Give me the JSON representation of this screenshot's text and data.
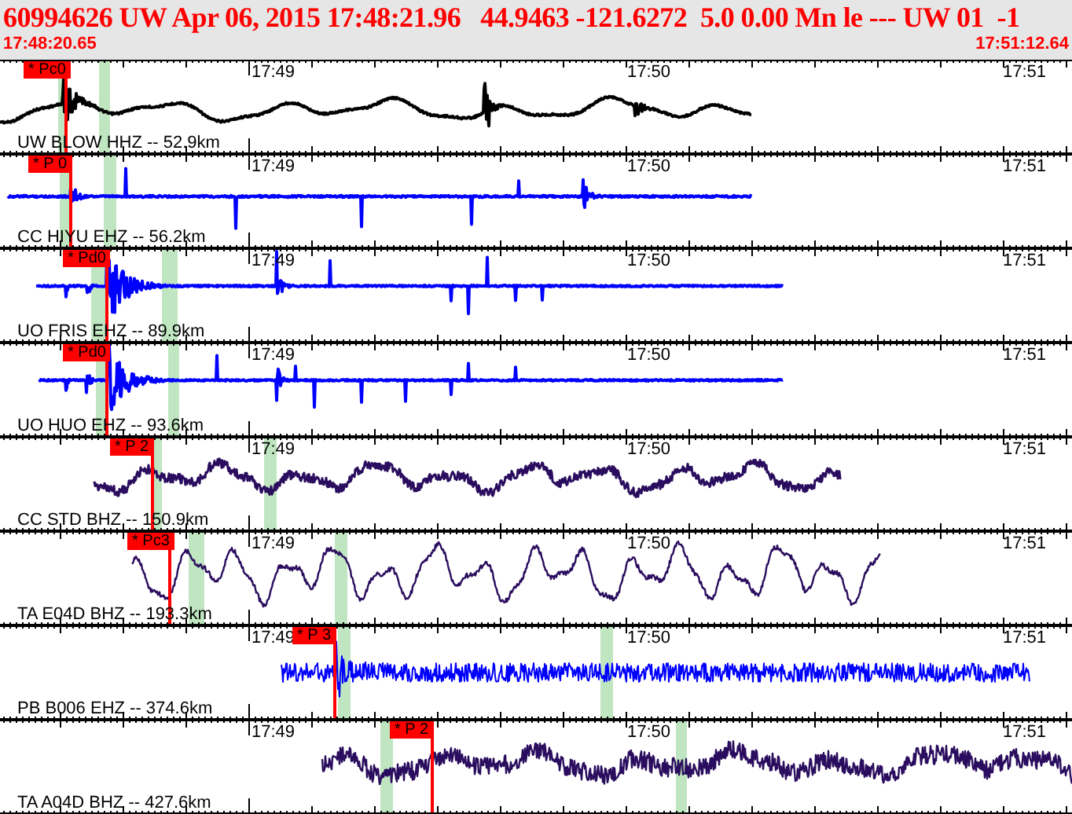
{
  "header": {
    "title": "60994626 UW Apr 06, 2015 17:48:21.96   44.9463 -121.6272  5.0 0.00 Mn le --- UW 01  -1",
    "start_time": "17:48:20.65",
    "end_time": "17:51:12.64"
  },
  "traces": [
    {
      "label": "UW BLOW HHZ -- 52.9km",
      "color": "#000000",
      "pick": "* Pc0",
      "time_labels": [
        "17:49",
        "17:50",
        "17:51"
      ]
    },
    {
      "label": "CC HIYU EHZ -- 56.2km",
      "color": "#0000ff",
      "pick": "* P 0",
      "time_labels": [
        "17:49",
        "17:50",
        "17:51"
      ]
    },
    {
      "label": "UO FRIS EHZ -- 89.9km",
      "color": "#0000ff",
      "pick": "* Pd0",
      "time_labels": [
        "17:49",
        "17:50",
        "17:51"
      ]
    },
    {
      "label": "UO HUO EHZ -- 93.6km",
      "color": "#0000ff",
      "pick": "* Pd0",
      "time_labels": [
        "17:49",
        "17:50",
        "17:51"
      ]
    },
    {
      "label": "CC STD BHZ -- 150.9km",
      "color": "#2a0d5e",
      "pick": "* P 2",
      "time_labels": [
        "17:49",
        "17:50",
        "17:51"
      ]
    },
    {
      "label": "TA E04D BHZ -- 193.3km",
      "color": "#2a0d5e",
      "pick": "* Pc3",
      "time_labels": [
        "17:49",
        "17:50",
        "17:51"
      ]
    },
    {
      "label": "PB B006 EHZ -- 374.6km",
      "color": "#0000ff",
      "pick": "* P 3",
      "time_labels": [
        "17:49",
        "17:50",
        "17:51"
      ]
    },
    {
      "label": "TA A04D BHZ -- 427.6km",
      "color": "#2a0d5e",
      "pick": "* P 2",
      "time_labels": [
        "17:49",
        "17:50",
        "17:51"
      ]
    }
  ]
}
